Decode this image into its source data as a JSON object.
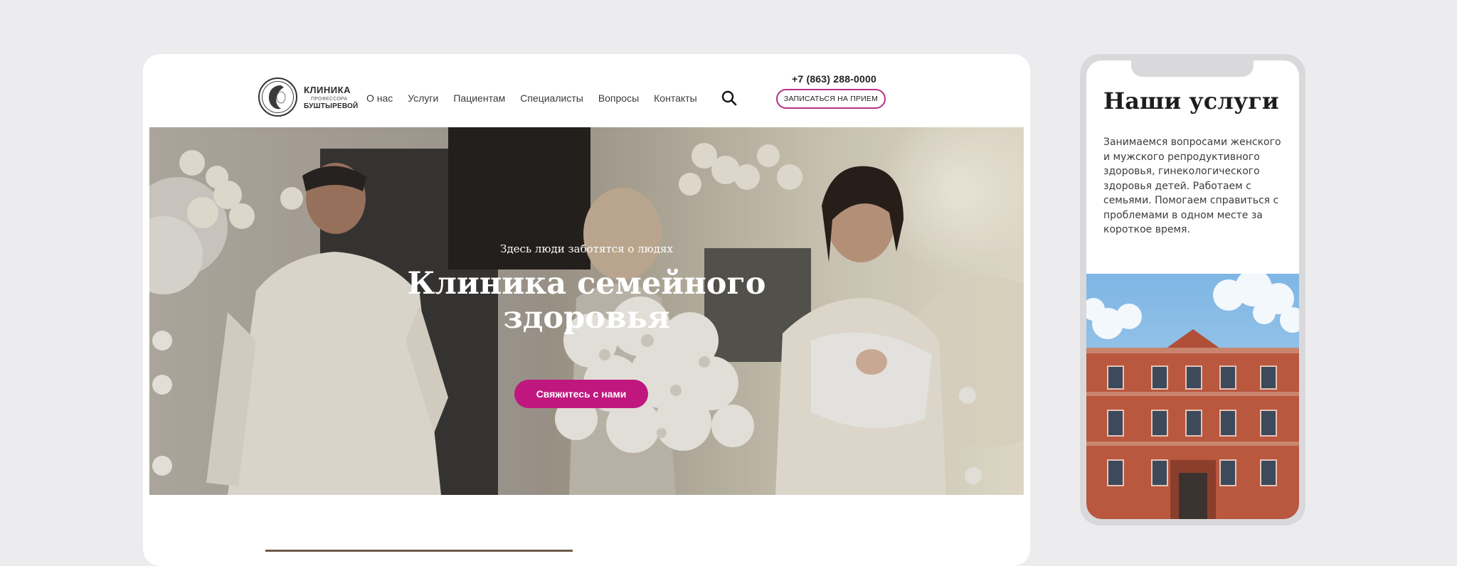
{
  "header": {
    "logo": {
      "line1": "КЛИНИКА",
      "line2": "ПРОФЕССОРА",
      "line3": "БУШТЫРЕВОЙ"
    },
    "nav": [
      "О нас",
      "Услуги",
      "Пациентам",
      "Специалисты",
      "Вопросы",
      "Контакты"
    ],
    "search_icon": "search-icon",
    "phone": "+7 (863) 288-0000",
    "appointment_button": "ЗАПИСАТЬСЯ НА ПРИЕМ"
  },
  "hero": {
    "eyebrow": "Здесь люди заботятся о людях",
    "title_line1": "Клиника семейного",
    "title_line2": "здоровья",
    "cta": "Свяжитесь с нами"
  },
  "mobile": {
    "title": "Наши услуги",
    "text": "Занимаемся вопросами женского и мужского репродуктивного здоровья, гинекологического здоровья детей. Работаем с семьями. Помогаем справиться с проблемами в одном месте за короткое время."
  },
  "colors": {
    "accent": "#c0177f",
    "outline": "#b5308a",
    "background": "#ececee"
  }
}
